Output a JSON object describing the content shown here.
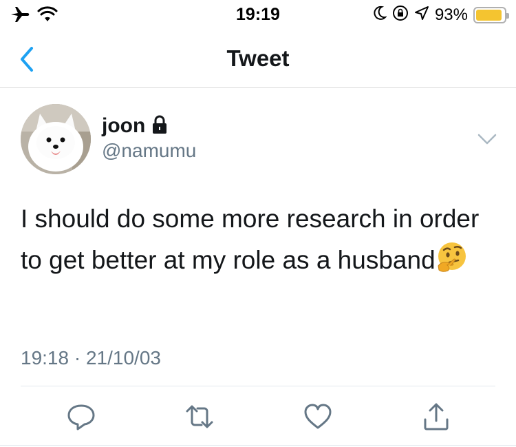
{
  "status_bar": {
    "time": "19:19",
    "battery_percent": "93%",
    "battery_level": 0.93,
    "icons": [
      "airplane-icon",
      "wifi-icon",
      "moon-icon",
      "rotation-lock-icon",
      "location-icon",
      "battery-icon"
    ]
  },
  "nav": {
    "title": "Tweet",
    "back_icon": "chevron-left-icon"
  },
  "tweet": {
    "author": {
      "display_name": "joon",
      "handle": "@namumu",
      "protected_icon": "lock-icon"
    },
    "text": "I should do some more research in order to get better at my role as a husband",
    "emoji": "thinking-face-emoji",
    "time": "19:18",
    "separator": "·",
    "date": "21/10/03"
  },
  "actions": [
    {
      "name": "reply",
      "icon": "reply-icon"
    },
    {
      "name": "retweet",
      "icon": "retweet-icon"
    },
    {
      "name": "like",
      "icon": "heart-icon"
    },
    {
      "name": "share",
      "icon": "share-icon"
    }
  ],
  "colors": {
    "accent": "#1da1f2",
    "text_primary": "#14171a",
    "text_secondary": "#657786",
    "battery": "#f4c430"
  }
}
